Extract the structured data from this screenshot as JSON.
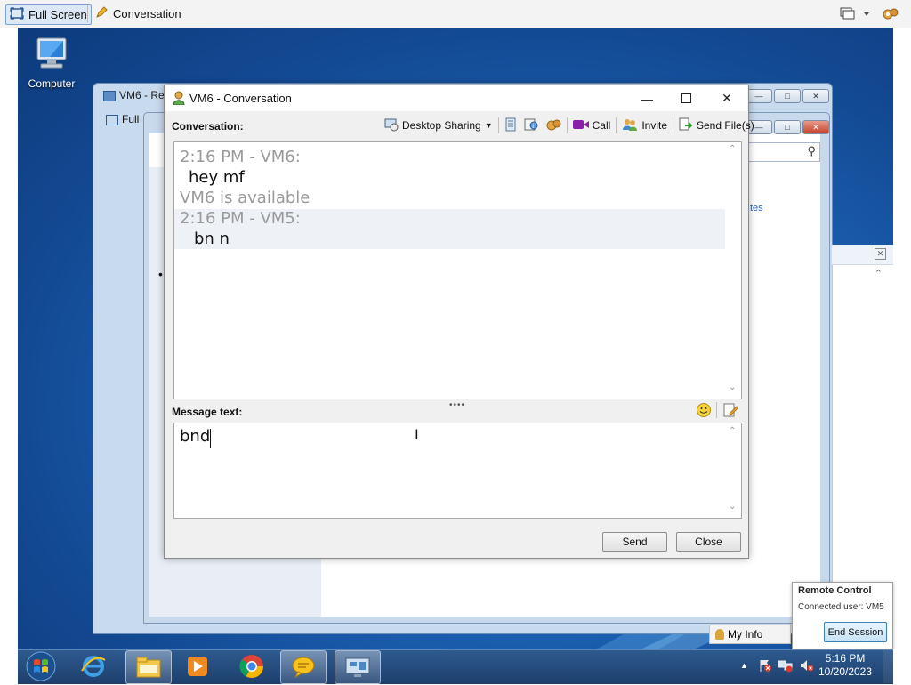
{
  "topbar": {
    "full_screen_label": "Full Screen",
    "conversation_label": "Conversation"
  },
  "desktop": {
    "computer_label": "Computer"
  },
  "background_windows": {
    "title": "VM6 - Rem",
    "full_label": "Full",
    "link_fragment": "tes",
    "my_info_label": "My Info"
  },
  "conversation_window": {
    "title": "VM6 - Conversation",
    "conversation_label": "Conversation:",
    "toolbar": {
      "desktop_sharing": "Desktop Sharing",
      "call": "Call",
      "invite": "Invite",
      "send_files": "Send File(s)"
    },
    "history": [
      {
        "text": "2:16 PM - VM6:",
        "style": "header"
      },
      {
        "text": "hey mf",
        "style": "message"
      },
      {
        "text": "VM6 is available",
        "style": "status"
      },
      {
        "text": "2:16 PM - VM5:",
        "style": "header"
      },
      {
        "text": "bn n",
        "style": "message"
      }
    ],
    "message_label": "Message text:",
    "message_value": "bnd",
    "send_label": "Send",
    "close_label": "Close"
  },
  "remote_control": {
    "title": "Remote Control",
    "connected_user": "Connected user: VM5",
    "end_session_label": "End Session"
  },
  "taskbar": {
    "time": "5:16 PM",
    "date": "10/20/2023"
  },
  "colors": {
    "desktop_blue": "#1e66b8",
    "taskbar_blue": "#2e5a8e",
    "call_icon": "#8b1fa8"
  }
}
